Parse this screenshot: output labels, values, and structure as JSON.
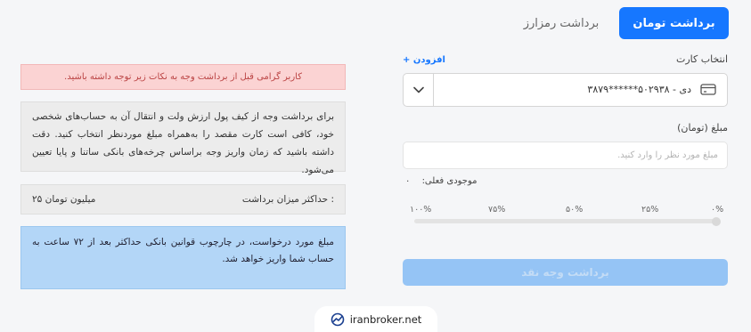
{
  "tabs": {
    "active": "برداشت تومان",
    "inactive": "برداشت رمزارز"
  },
  "left": {
    "alert": "کاربر گرامی قبل از برداشت وجه به نکات زیر توجه داشته باشید.",
    "info": "برای برداشت وجه از کیف پول ارزش ولت و انتقال آن به حساب‌های شخصی خود، کافی است کارت مقصد را به‌همراه مبلغ موردنظر انتخاب کنید. دقت داشته باشید که زمان واریز وجه براساس چرخه‌های بانکی ساتنا و پایا تعیین می‌شود.",
    "max_label": "حداکثر میزان برداشت :",
    "max_value": "۲۵ میلیون تومان",
    "notice": "مبلغ مورد درخواست، در چارچوب قوانین بانکی حداکثر بعد از ۷۲ ساعت به حساب شما واریز خواهد شد."
  },
  "card": {
    "label": "انتخاب کارت",
    "add_label": "+ افزودن",
    "selected": "دی - ۵۰۲۹۳۸******۳۸۷۹",
    "icon": "credit-card-icon"
  },
  "amount": {
    "label": "مبلغ (تومان)",
    "placeholder": "مبلغ مورد نظر را وارد کنید."
  },
  "balance": {
    "label": "موجودی فعلی:",
    "value": "۰"
  },
  "slider": {
    "value_percent": 0,
    "marks": [
      "۰%",
      "۲۵%",
      "۵۰%",
      "۷۵%",
      "۱۰۰%"
    ]
  },
  "submit_label": "برداشت وجه نقد",
  "watermark": "iranbroker.net",
  "colors": {
    "primary": "#1677ff",
    "alert_bg": "#fbd3d3",
    "notice_bg": "#b3d6f7",
    "disabled_btn": "#95c4f5"
  }
}
